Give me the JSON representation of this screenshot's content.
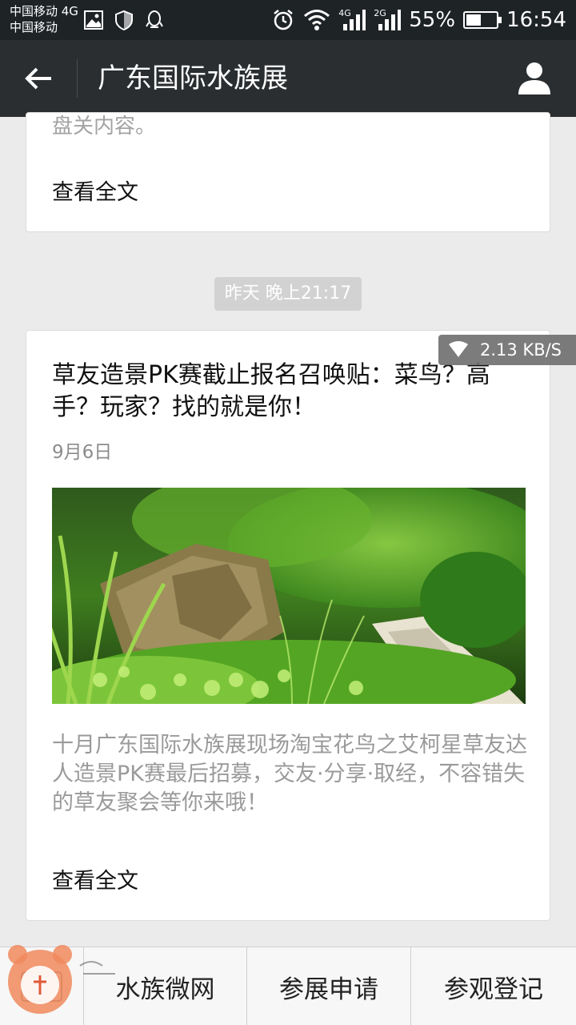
{
  "status_bar": {
    "carrier_1": "中国移动 4G",
    "carrier_2": "中国移动",
    "net1": "4G",
    "net2": "2G",
    "battery_percent": "55%",
    "battery_level": 0.55,
    "time": "16:54",
    "icons": [
      "image-icon",
      "shield-icon",
      "qq-icon",
      "alarm-icon",
      "wifi-icon",
      "signal-icon",
      "signal-icon",
      "battery-icon"
    ]
  },
  "nav": {
    "title": "广东国际水族展",
    "back_icon": "back-arrow-icon",
    "profile_icon": "person-icon"
  },
  "card1": {
    "cut_text": "盘关内容。",
    "read_more": "查看全文"
  },
  "timestamp": "昨天 晚上21:17",
  "article": {
    "title": "草友造景PK赛截止报名召唤贴：菜鸟？高手？玩家？找的就是你！",
    "date": "9月6日",
    "image_desc": "aquascape-photo",
    "description": "十月广东国际水族展现场淘宝花鸟之艾柯星草友达人造景PK赛最后招募，交友·分享·取经，不容错失的草友聚会等你来哦！",
    "read_more": "查看全文"
  },
  "speed_badge": {
    "text": "2.13 KB/S"
  },
  "bottom_menu": {
    "items": [
      {
        "label": "水族微网"
      },
      {
        "label": "参展申请"
      },
      {
        "label": "参观登记"
      }
    ]
  },
  "colors": {
    "status_bg": "#1e2326",
    "nav_bg": "#2a2e31",
    "page_bg": "#ebebeb",
    "timestamp_bg": "#d2d2d2"
  }
}
